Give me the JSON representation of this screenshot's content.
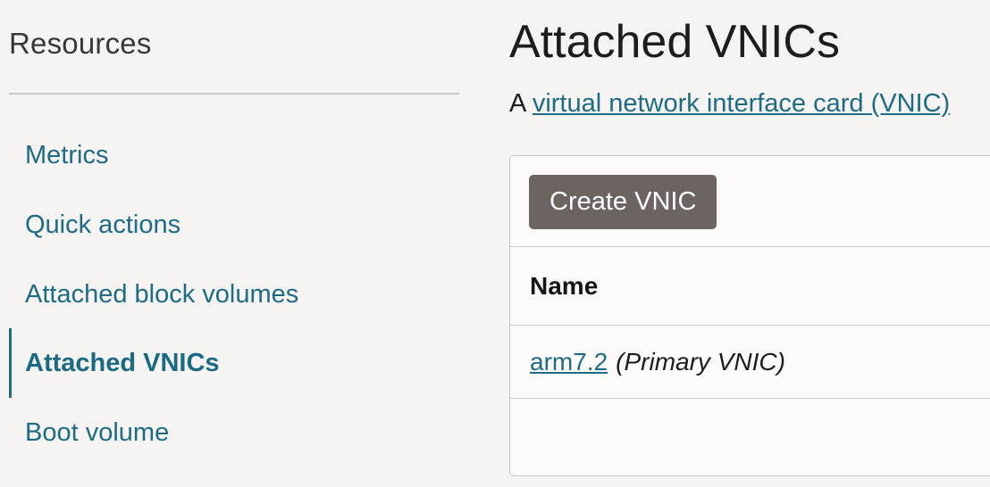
{
  "sidebar": {
    "title": "Resources",
    "items": [
      {
        "label": "Metrics",
        "active": false
      },
      {
        "label": "Quick actions",
        "active": false
      },
      {
        "label": "Attached block volumes",
        "active": false
      },
      {
        "label": "Attached VNICs",
        "active": true
      },
      {
        "label": "Boot volume",
        "active": false
      }
    ]
  },
  "main": {
    "title": "Attached VNICs",
    "intro_prefix": "A",
    "intro_link": "virtual network interface card (VNIC)",
    "create_button": "Create VNIC",
    "table": {
      "columns": [
        "Name"
      ],
      "rows": [
        {
          "name": "arm7.2",
          "note": "(Primary VNIC)"
        }
      ]
    }
  },
  "colors": {
    "accent": "#1e6b85",
    "button": "#6b6460",
    "background": "#f5f4f2"
  }
}
